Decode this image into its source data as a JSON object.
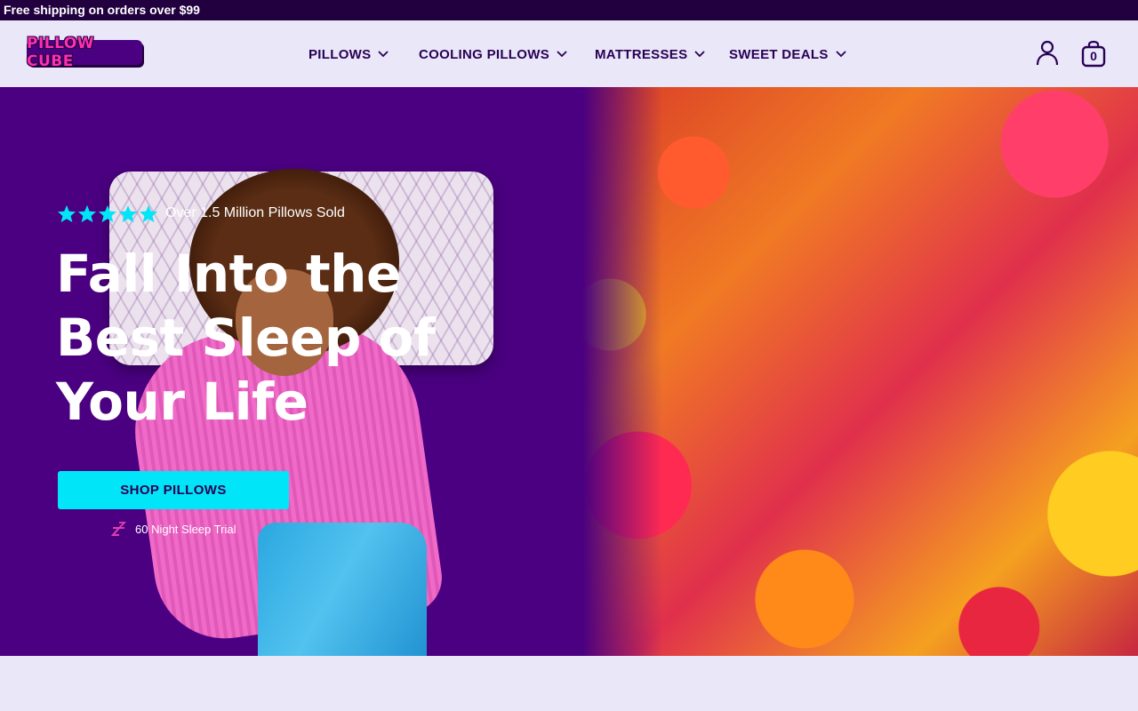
{
  "announcement": {
    "text": "Free shipping on orders over $99"
  },
  "header": {
    "logo_text": "PILLOW CUBE",
    "nav": [
      {
        "label": "PILLOWS"
      },
      {
        "label": "COOLING PILLOWS"
      },
      {
        "label": "MATTRESSES"
      },
      {
        "label": "SWEET DEALS"
      }
    ],
    "account_icon": "user-icon",
    "cart_icon": "shopping-bag-icon",
    "cart_count": "0"
  },
  "hero": {
    "rating_stars": 5,
    "rating_text": "Over 1.5 Million Pillows Sold",
    "headline_lines": [
      "Fall Into the",
      "Best Sleep of",
      "Your Life"
    ],
    "cta_label": "SHOP PILLOWS",
    "trial_icon": "zzz-sleep-icon",
    "trial_text": "60 Night Sleep Trial"
  },
  "colors": {
    "announcement_bg": "#22003f",
    "header_bg": "#e9e7f8",
    "hero_bg": "#4a0080",
    "accent_cyan": "#00e5f7",
    "star_color": "#00e5f7",
    "brand_pink": "#ff2fb0",
    "nav_text": "#2a0055"
  }
}
